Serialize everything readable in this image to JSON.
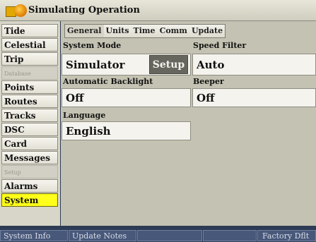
{
  "header": {
    "title": "Simulating Operation",
    "icon": "garmin-sun-flag-icon"
  },
  "sidebar": {
    "items": [
      {
        "label": "Tide",
        "state": "normal"
      },
      {
        "label": "Celestial",
        "state": "normal"
      },
      {
        "label": "Trip",
        "state": "normal"
      },
      {
        "label": "Database",
        "state": "section"
      },
      {
        "label": "Points",
        "state": "normal"
      },
      {
        "label": "Routes",
        "state": "normal"
      },
      {
        "label": "Tracks",
        "state": "normal"
      },
      {
        "label": "DSC",
        "state": "normal"
      },
      {
        "label": "Card",
        "state": "normal"
      },
      {
        "label": "Messages",
        "state": "normal"
      },
      {
        "label": "Setup",
        "state": "section"
      },
      {
        "label": "Alarms",
        "state": "normal"
      },
      {
        "label": "System",
        "state": "selected"
      }
    ]
  },
  "main": {
    "tabs": [
      "General",
      "Units",
      "Time",
      "Comm",
      "Update"
    ],
    "system_mode": {
      "label": "System Mode",
      "value": "Simulator",
      "button": "Setup"
    },
    "speed_filter": {
      "label": "Speed Filter",
      "value": "Auto"
    },
    "auto_backlight": {
      "label": "Automatic Backlight",
      "value": "Off"
    },
    "beeper": {
      "label": "Beeper",
      "value": "Off"
    },
    "language": {
      "label": "Language",
      "value": "English"
    }
  },
  "footer": {
    "system_info": "System Info",
    "update_notes": "Update Notes",
    "factory_dflt": "Factory Dflt"
  },
  "colors": {
    "selected": "#ffff1a",
    "panel": "#c4c2b2",
    "background": "#2e3b55"
  }
}
